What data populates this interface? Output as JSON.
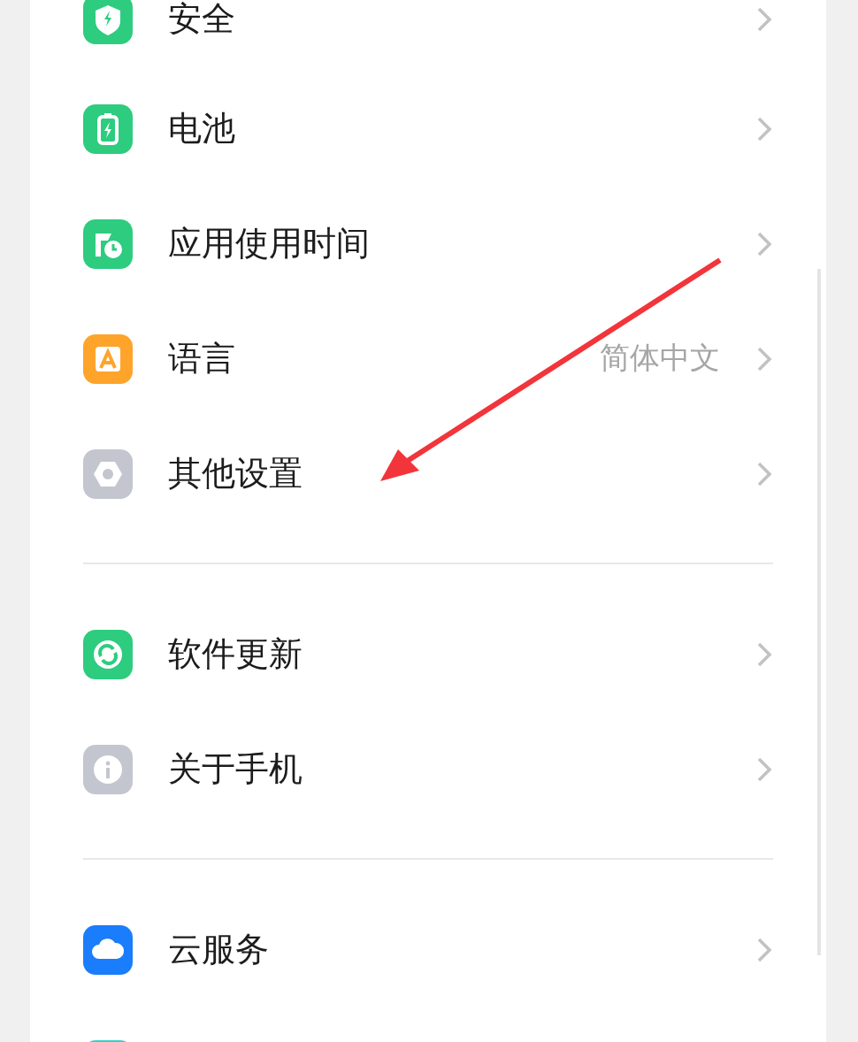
{
  "sections": [
    {
      "items": [
        {
          "kind": "shield",
          "label": "安全"
        },
        {
          "kind": "battery",
          "label": "电池"
        },
        {
          "kind": "timer",
          "label": "应用使用时间"
        },
        {
          "kind": "language",
          "label": "语言",
          "value": "简体中文"
        },
        {
          "kind": "settings",
          "label": "其他设置"
        }
      ]
    },
    {
      "items": [
        {
          "kind": "update",
          "label": "软件更新"
        },
        {
          "kind": "info",
          "label": "关于手机"
        }
      ]
    },
    {
      "items": [
        {
          "kind": "cloud",
          "label": "云服务"
        },
        {
          "kind": "partial"
        }
      ]
    }
  ]
}
